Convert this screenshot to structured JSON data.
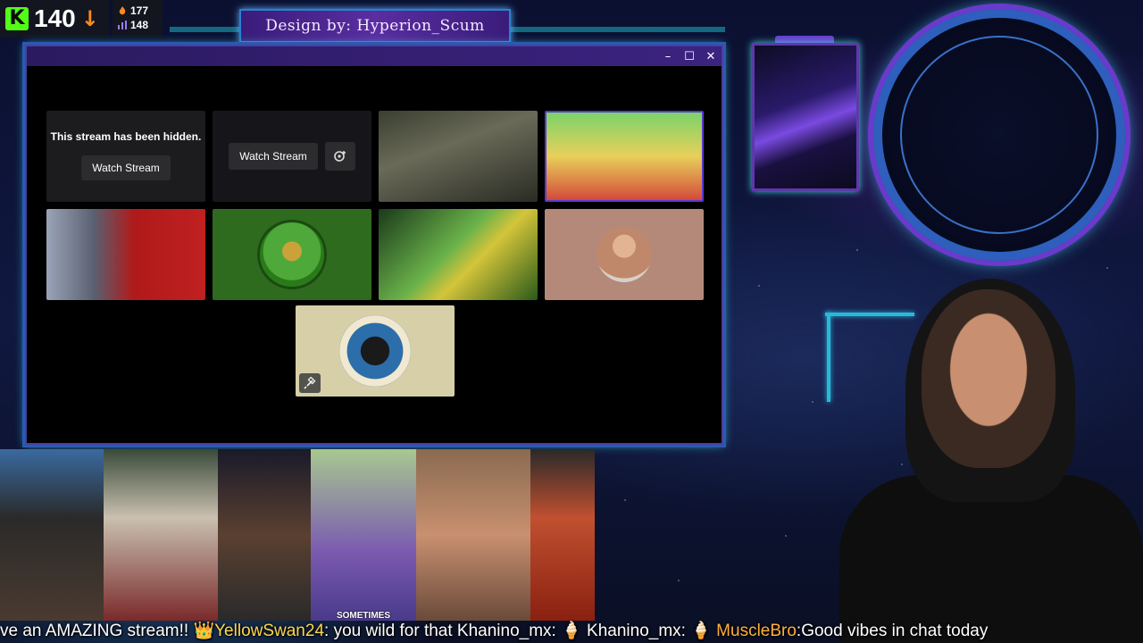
{
  "counters": {
    "kick_logo": "K",
    "viewers": "140",
    "trend_icon": "arrow-down-icon",
    "followers": "177",
    "subs": "148"
  },
  "banner": {
    "text": "Design by: Hyperion_Scum"
  },
  "window": {
    "controls": [
      "–",
      "☐",
      "✕"
    ],
    "tiles": [
      {
        "kind": "hidden",
        "message": "This stream has been hidden.",
        "button": "Watch Stream"
      },
      {
        "kind": "blurred",
        "button": "Watch Stream",
        "icon": "pin-plus-icon"
      },
      {
        "kind": "stream",
        "label": "game-stream-1"
      },
      {
        "kind": "stream",
        "label": "game-stream-2"
      },
      {
        "kind": "stream",
        "label": "red-stream"
      },
      {
        "kind": "avatar",
        "label": "pepe-avatar"
      },
      {
        "kind": "stream",
        "label": "map-stream"
      },
      {
        "kind": "avatar",
        "label": "muscle-avatar"
      },
      {
        "kind": "avatar",
        "label": "seal-avatar",
        "icon": "unpin-icon"
      }
    ]
  },
  "portraits": {
    "caption": "SOMETIMES"
  },
  "ticker": {
    "segments": [
      {
        "text": "ve an AMAZING stream!! ",
        "class": ""
      },
      {
        "text": "👑",
        "class": "t-gold"
      },
      {
        "text": "YellowSwan24",
        "class": "t-gold"
      },
      {
        "text": ": you wild for that ",
        "class": ""
      },
      {
        "text": "Khanino_mx",
        "class": ""
      },
      {
        "text": ": 🍦  ",
        "class": ""
      },
      {
        "text": "Khanino_mx",
        "class": ""
      },
      {
        "text": ": 🍦  ",
        "class": ""
      },
      {
        "text": "MuscleBro",
        "class": "t-orange"
      },
      {
        "text": ":Good vibes in chat today",
        "class": ""
      }
    ]
  }
}
